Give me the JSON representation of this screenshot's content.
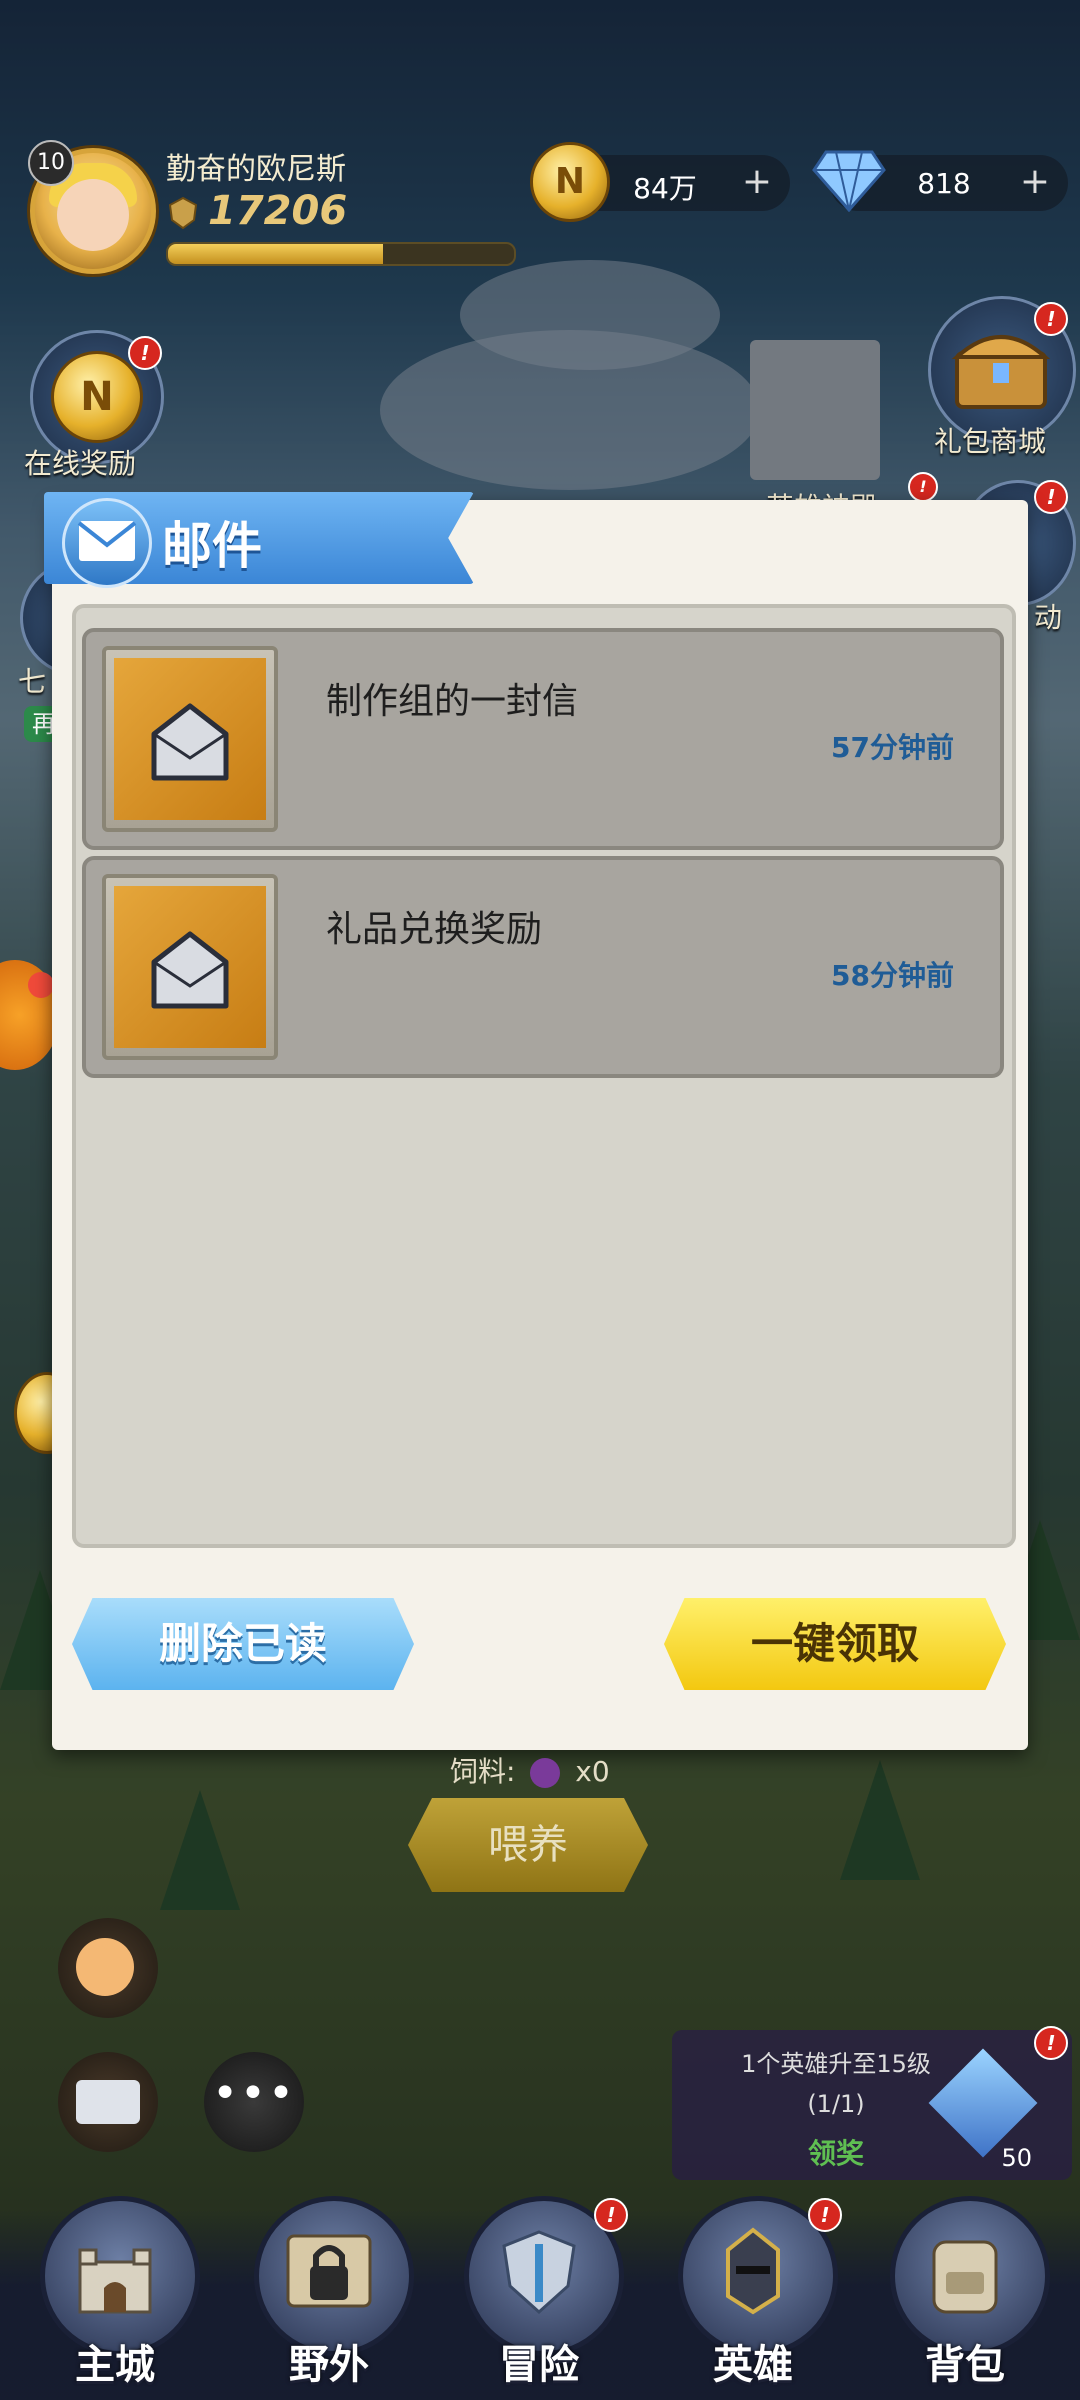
{
  "player": {
    "level": "10",
    "name": "勤奋的欧尼斯",
    "power": "17206",
    "xp_fraction": 0.62
  },
  "resources": {
    "gold": "84万",
    "diamonds": "818",
    "plus": "+"
  },
  "side_left": {
    "online_reward": "在线奖励",
    "seven_label": "七",
    "seven_sub": "再"
  },
  "side_right": {
    "gift_shop": "礼包商城",
    "hero_temple": "英雄神殿",
    "activity_partial": "动"
  },
  "mail": {
    "title": "邮件",
    "items": [
      {
        "subject": "制作组的一封信",
        "time": "57分钟前"
      },
      {
        "subject": "礼品兑换奖励",
        "time": "58分钟前"
      }
    ],
    "delete_read_label": "删除已读",
    "claim_all_label": "一键领取"
  },
  "scene": {
    "feed_label": "饲料:",
    "feed_count": "x0",
    "feed_button": "喂养"
  },
  "quest": {
    "title": "1个英雄升至15级",
    "progress": "(1/1)",
    "claim": "领奖",
    "reward_count": "50"
  },
  "nav": [
    {
      "label": "主城"
    },
    {
      "label": "野外"
    },
    {
      "label": "冒险"
    },
    {
      "label": "英雄"
    },
    {
      "label": "背包"
    }
  ],
  "colors": {
    "accent_blue": "#3b86d6",
    "claim_yellow": "#f3c810",
    "mail_time": "#1f5c96",
    "badge_red": "#d6271f"
  }
}
